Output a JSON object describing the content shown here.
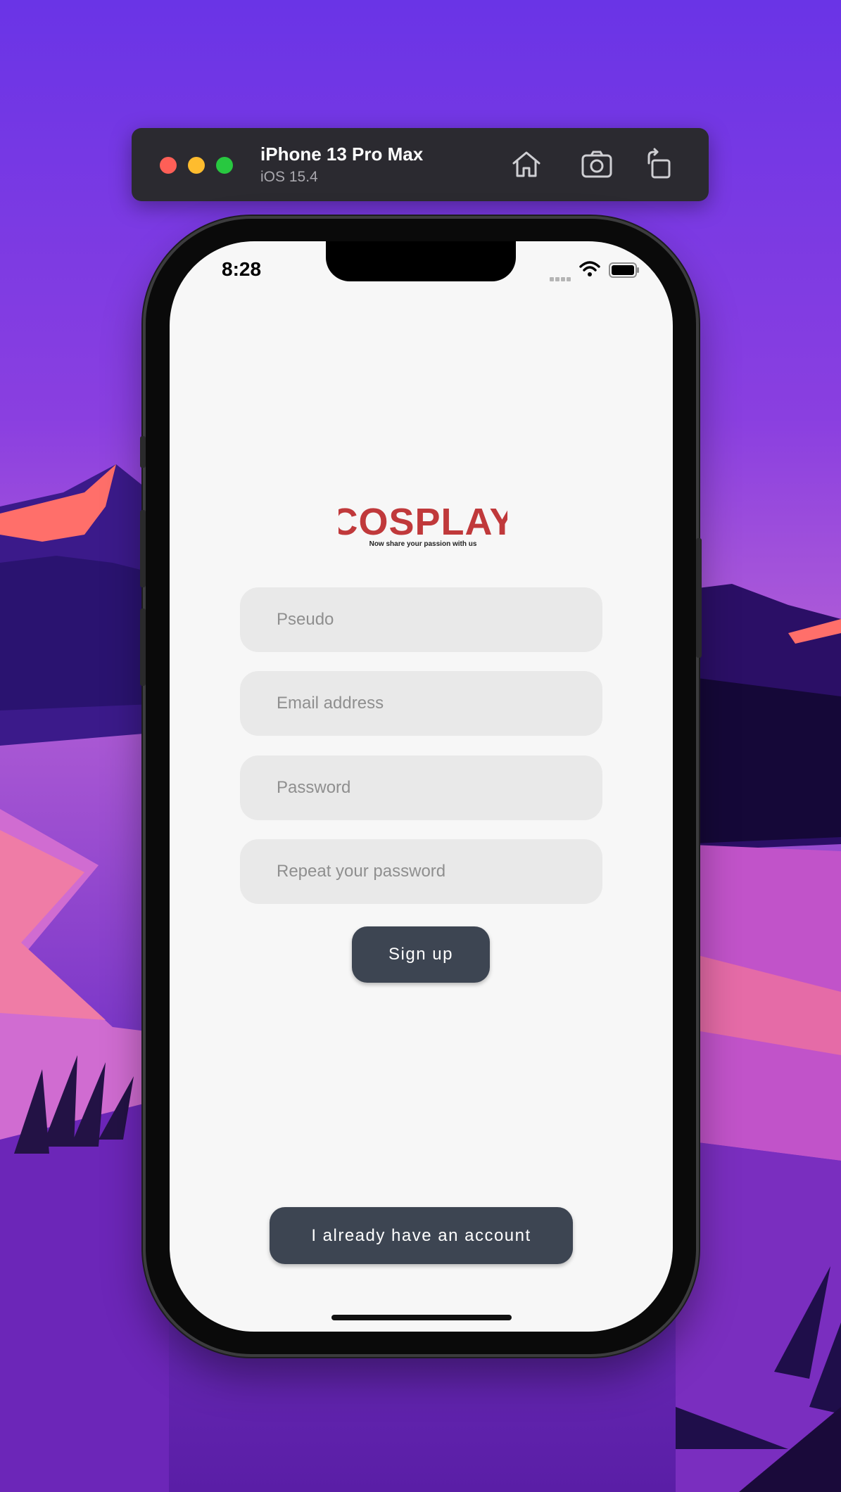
{
  "simulator": {
    "device_name": "iPhone 13 Pro Max",
    "os_version": "iOS 15.4",
    "buttons": [
      "home-icon",
      "screenshot-icon",
      "rotate-icon"
    ]
  },
  "status_bar": {
    "time": "8:28"
  },
  "logo": {
    "title": "COSPLAY",
    "tagline": "Now share your passion with us",
    "color": "#c0393b"
  },
  "form": {
    "pseudo_placeholder": "Pseudo",
    "email_placeholder": "Email address",
    "password_placeholder": "Password",
    "repeat_password_placeholder": "Repeat your password"
  },
  "actions": {
    "signup_label": "Sign up",
    "login_label": "I already have an account"
  },
  "colors": {
    "button": "#3d4552",
    "field": "#e9e9e9",
    "screen_bg": "#f7f7f7",
    "accent": "#c0393b"
  }
}
